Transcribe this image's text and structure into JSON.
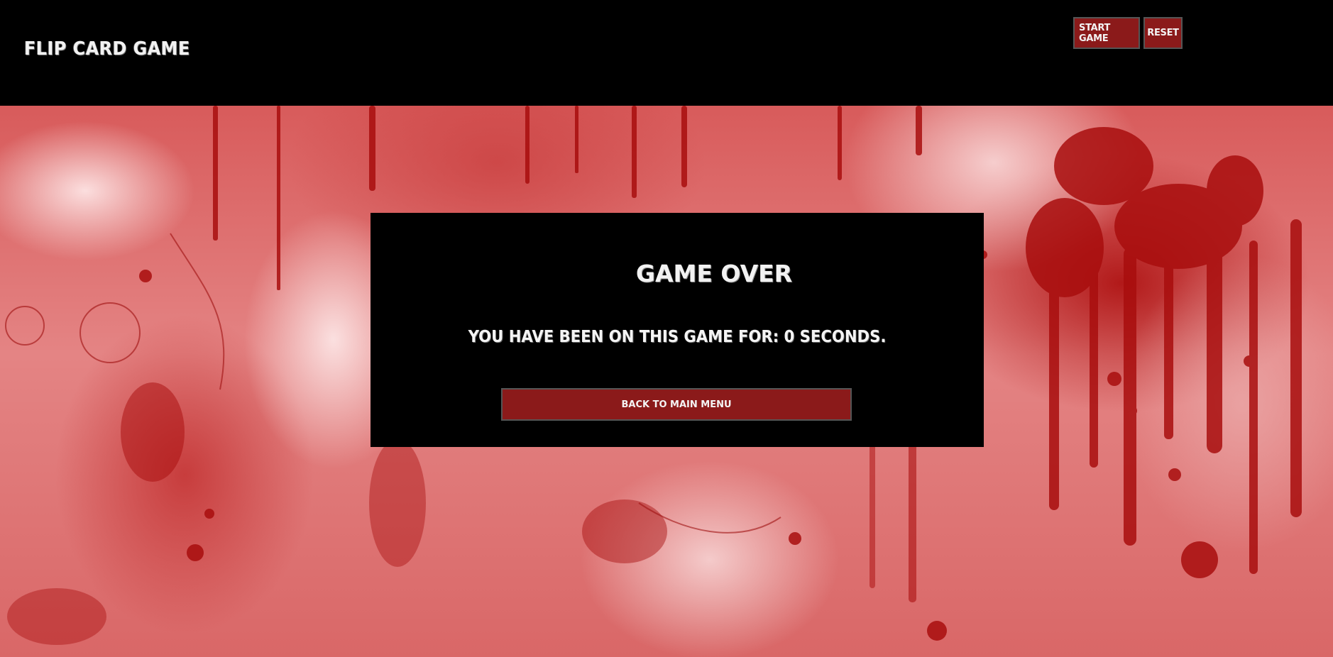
{
  "header": {
    "title": "Flip Card Game",
    "buttons": {
      "start_label": "Start Game",
      "reset_label": "Reset"
    }
  },
  "modal": {
    "title": "Game Over",
    "message": "You have been on this game for: 0 seconds.",
    "back_label": "Back to main menu"
  },
  "colors": {
    "header_bg": "#000000",
    "button_bg": "#8b1a1a",
    "modal_bg": "#000000",
    "blood_red": "#b01414",
    "text": "#f4f4f4"
  }
}
